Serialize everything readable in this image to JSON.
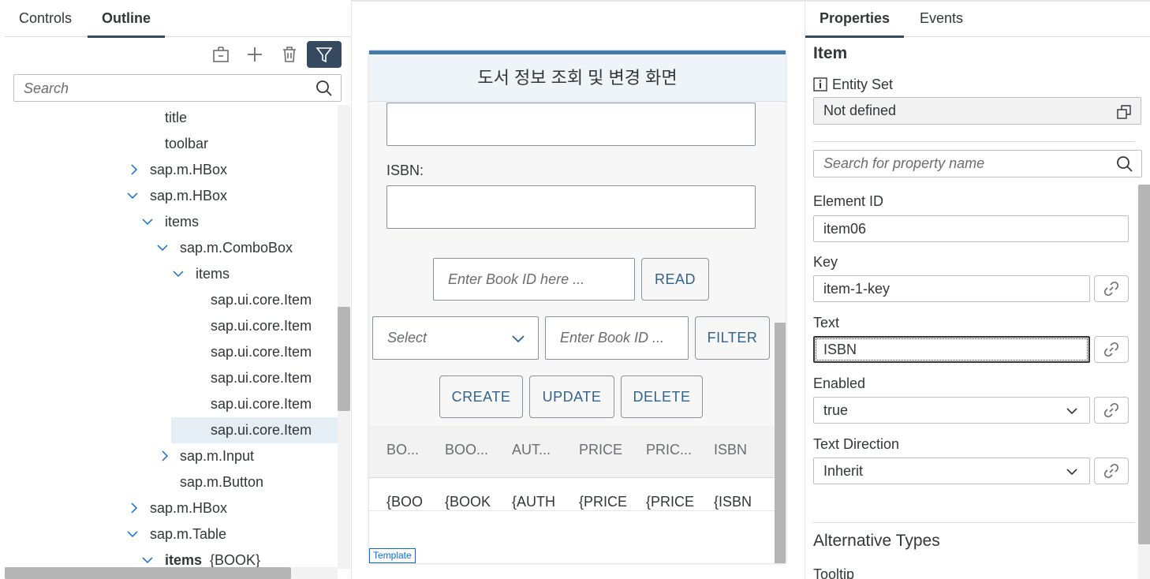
{
  "left_panel": {
    "tabs": [
      {
        "label": "Controls"
      },
      {
        "label": "Outline"
      }
    ],
    "active_tab": "Outline",
    "toolbar_icons": [
      "wrap-icon",
      "add-icon",
      "delete-icon",
      "filter-icon"
    ],
    "search": {
      "placeholder": "Search"
    },
    "tree": [
      {
        "label": "title"
      },
      {
        "label": "toolbar"
      },
      {
        "label": "sap.m.HBox",
        "state": "collapsed"
      },
      {
        "label": "sap.m.HBox",
        "state": "expanded"
      },
      {
        "label": "items",
        "state": "expanded"
      },
      {
        "label": "sap.m.ComboBox",
        "state": "expanded"
      },
      {
        "label": "items",
        "state": "expanded"
      },
      {
        "label": "sap.ui.core.Item"
      },
      {
        "label": "sap.ui.core.Item"
      },
      {
        "label": "sap.ui.core.Item"
      },
      {
        "label": "sap.ui.core.Item"
      },
      {
        "label": "sap.ui.core.Item"
      },
      {
        "label": "sap.ui.core.Item",
        "selected": true
      },
      {
        "label": "sap.m.Input",
        "state": "collapsed"
      },
      {
        "label": "sap.m.Button"
      },
      {
        "label": "sap.m.HBox",
        "state": "collapsed"
      },
      {
        "label": "sap.m.Table",
        "state": "expanded"
      },
      {
        "label": "items",
        "sub": "{BOOK}",
        "state": "expanded"
      }
    ]
  },
  "canvas": {
    "header_title": "도서 정보 조회 및 변경 화면",
    "isbn_label": "ISBN:",
    "book_id_input": {
      "placeholder": "Enter Book ID here ..."
    },
    "read_button": "READ",
    "select": {
      "placeholder": "Select"
    },
    "filter_input": {
      "placeholder": "Enter Book ID ..."
    },
    "filter_button": "FILTER",
    "create_button": "CREATE",
    "update_button": "UPDATE",
    "delete_button": "DELETE",
    "table": {
      "columns": [
        "BO...",
        "BOO...",
        "AUT...",
        "PRICE",
        "PRIC...",
        "ISBN"
      ],
      "row": [
        "{BOO",
        "{BOOK",
        "{AUTH",
        "{PRICE",
        "{PRICE",
        "{ISBN"
      ]
    },
    "template_tag": "Template"
  },
  "right_panel": {
    "tabs": [
      {
        "label": "Properties"
      },
      {
        "label": "Events"
      }
    ],
    "active_tab": "Properties",
    "title": "Item",
    "entity_set_label": "Entity Set",
    "entity_set_value": "Not defined",
    "search": {
      "placeholder": "Search for property name"
    },
    "element_id_label": "Element ID",
    "element_id_value": "item06",
    "key_label": "Key",
    "key_value": "item-1-key",
    "text_label": "Text",
    "text_value": "ISBN",
    "enabled_label": "Enabled",
    "enabled_value": "true",
    "text_direction_label": "Text Direction",
    "text_direction_value": "Inherit",
    "alt_types_heading": "Alternative Types",
    "tooltip_label": "Tooltip"
  },
  "colors": {
    "accent": "#354a5f",
    "device_topbar": "#427cac",
    "button_text": "#32638f",
    "selection": "#e5edf5"
  }
}
